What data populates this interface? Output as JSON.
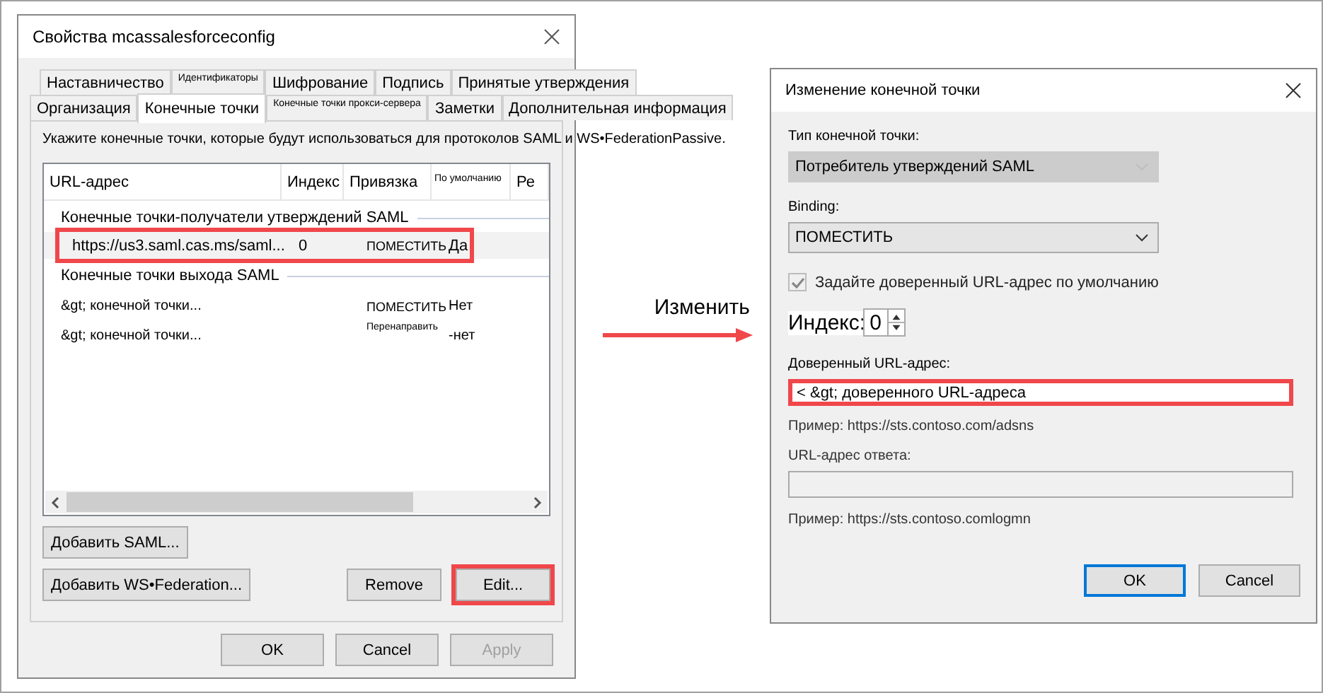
{
  "properties_dialog": {
    "title": "Свойства mcassalesforceconfig",
    "tab_rows": [
      [
        {
          "label": "Наставничество",
          "selected": false,
          "small": false
        },
        {
          "label": "Идентификаторы",
          "selected": false,
          "small": true
        },
        {
          "label": "Шифрование",
          "selected": false,
          "small": false
        },
        {
          "label": "Подпись",
          "selected": false,
          "small": false
        },
        {
          "label": "Принятые утверждения",
          "selected": false,
          "small": false
        }
      ],
      [
        {
          "label": "Организация",
          "selected": false,
          "small": false
        },
        {
          "label": "Конечные точки",
          "selected": true,
          "small": false
        },
        {
          "label": "Конечные точки прокси-сервера",
          "selected": false,
          "small": true
        },
        {
          "label": "Заметки",
          "selected": false,
          "small": false
        },
        {
          "label": "Дополнительная информация",
          "selected": false,
          "small": false
        }
      ]
    ],
    "instruction": "Укажите конечные точки, которые будут использоваться для протоколов SAML и WS•FederationPassive.",
    "table": {
      "columns": [
        {
          "label": "URL-адрес",
          "small": false
        },
        {
          "label": "Индекс",
          "small": false
        },
        {
          "label": "Привязка",
          "small": false
        },
        {
          "label": "По умолчанию",
          "small": true
        },
        {
          "label": "Ре",
          "small": false
        }
      ],
      "groups": [
        {
          "label": "Конечные точки-получатели утверждений SAML",
          "rows": [
            {
              "cells": [
                "https://us3.saml.cas.ms/saml...",
                "0",
                "ПОМЕСТИТЬ",
                "Да"
              ],
              "small_binding": false,
              "selected": true,
              "highlighted": true
            }
          ]
        },
        {
          "label": "Конечные точки выхода SAML",
          "rows": [
            {
              "cells": [
                "&gt; конечной точки...",
                "",
                "ПОМЕСТИТЬ",
                "Нет"
              ],
              "small_binding": false,
              "selected": false,
              "highlighted": false
            },
            {
              "cells": [
                "&gt; конечной точки...",
                "",
                "Перенаправить",
                "-нет"
              ],
              "small_binding": true,
              "selected": false,
              "highlighted": false
            }
          ]
        }
      ]
    },
    "side_buttons": [
      {
        "label": "Добавить SAML...",
        "highlighted": false
      },
      {
        "label": "Добавить WS•Federation...",
        "highlighted": false
      }
    ],
    "action_buttons": [
      {
        "label": "Remove",
        "highlighted": false
      },
      {
        "label": "Edit...",
        "highlighted": true
      }
    ],
    "footer_buttons": [
      {
        "label": "OK",
        "disabled": false
      },
      {
        "label": "Cancel",
        "disabled": false
      },
      {
        "label": "Apply",
        "disabled": true
      }
    ]
  },
  "arrow_label": "Изменить",
  "edit_dialog": {
    "title": "Изменение конечной точки",
    "endpoint_type": {
      "label": "Тип конечной точки:",
      "value": "Потребитель утверждений SAML",
      "disabled": true
    },
    "binding": {
      "label": "Binding:",
      "value": "ПОМЕСТИТЬ",
      "disabled": false
    },
    "default_checkbox": {
      "label": "Задайте доверенный URL-адрес по умолчанию",
      "checked": true,
      "disabled": true
    },
    "index": {
      "label": "Индекс:",
      "value": "0"
    },
    "trusted_url": {
      "label": "Доверенный URL-адрес:",
      "value": "< &gt; доверенного URL-адреса",
      "highlighted": true
    },
    "trusted_example": "Пример: https://sts.contoso.com/adsns",
    "response_url": {
      "label": "URL-адрес ответа:",
      "disabled": true
    },
    "response_example": "Пример: https://sts.contoso.comlogmn",
    "buttons": [
      {
        "label": "OK",
        "default": true
      },
      {
        "label": "Cancel",
        "default": false
      }
    ]
  }
}
